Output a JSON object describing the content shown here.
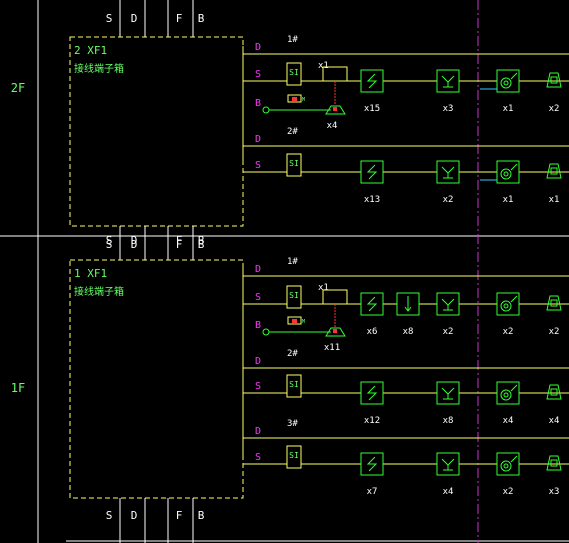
{
  "floors": [
    {
      "label": "2F",
      "box": {
        "title": "2 XF1",
        "subtitle": "接线端子箱"
      },
      "bus_labels": [
        "S",
        "D",
        "F",
        "B"
      ],
      "branches": [
        {
          "number": "1#",
          "lines": [
            {
              "tag": "D"
            },
            {
              "tag": "S",
              "sw": "SI"
            },
            {
              "tag": "B"
            }
          ],
          "extra": {
            "module": "x1",
            "below": "x4"
          },
          "devices": [
            {
              "type": "smoke",
              "count": "x15"
            },
            {
              "type": "heat",
              "count": "x3"
            },
            {
              "type": "hydrant",
              "count": "x1"
            },
            {
              "type": "bell",
              "count": "x2"
            }
          ]
        },
        {
          "number": "2#",
          "lines": [
            {
              "tag": "D"
            },
            {
              "tag": "S",
              "sw": "SI"
            }
          ],
          "devices": [
            {
              "type": "smoke",
              "count": "x13"
            },
            {
              "type": "heat",
              "count": "x2"
            },
            {
              "type": "hydrant",
              "count": "x1"
            },
            {
              "type": "bell",
              "count": "x1"
            }
          ]
        }
      ]
    },
    {
      "label": "1F",
      "box": {
        "title": "1 XF1",
        "subtitle": "接线端子箱"
      },
      "bus_labels": [
        "S",
        "D",
        "F",
        "B"
      ],
      "branches": [
        {
          "number": "1#",
          "lines": [
            {
              "tag": "D"
            },
            {
              "tag": "S",
              "sw": "SI"
            },
            {
              "tag": "B"
            }
          ],
          "extra": {
            "module": "x1",
            "below": "x11"
          },
          "devices": [
            {
              "type": "smoke",
              "count": "x6"
            },
            {
              "type": "flow",
              "count": "x8"
            },
            {
              "type": "heat",
              "count": "x2"
            },
            {
              "type": "hydrant",
              "count": "x2"
            },
            {
              "type": "bell",
              "count": "x2"
            }
          ]
        },
        {
          "number": "2#",
          "lines": [
            {
              "tag": "D"
            },
            {
              "tag": "S",
              "sw": "SI"
            }
          ],
          "devices": [
            {
              "type": "smoke",
              "count": "x12"
            },
            {
              "type": "heat",
              "count": "x8"
            },
            {
              "type": "hydrant",
              "count": "x4"
            },
            {
              "type": "bell",
              "count": "x4"
            }
          ]
        },
        {
          "number": "3#",
          "lines": [
            {
              "tag": "D"
            },
            {
              "tag": "S",
              "sw": "SI"
            }
          ],
          "devices": [
            {
              "type": "smoke",
              "count": "x7"
            },
            {
              "type": "heat",
              "count": "x4"
            },
            {
              "type": "hydrant",
              "count": "x2"
            },
            {
              "type": "bell",
              "count": "x3"
            }
          ]
        }
      ]
    }
  ],
  "bottom_bus_labels": [
    "S",
    "D",
    "F",
    "B"
  ],
  "colors": {
    "wire": "#ffff66",
    "device": "#33ff33",
    "text_green": "#66ff66",
    "text_magenta": "#ff33ff",
    "grid": "#ffffff",
    "divider": "#cc33cc",
    "box": "#ffff66",
    "terminal": "#ff3333",
    "cyan": "#33ccff"
  }
}
